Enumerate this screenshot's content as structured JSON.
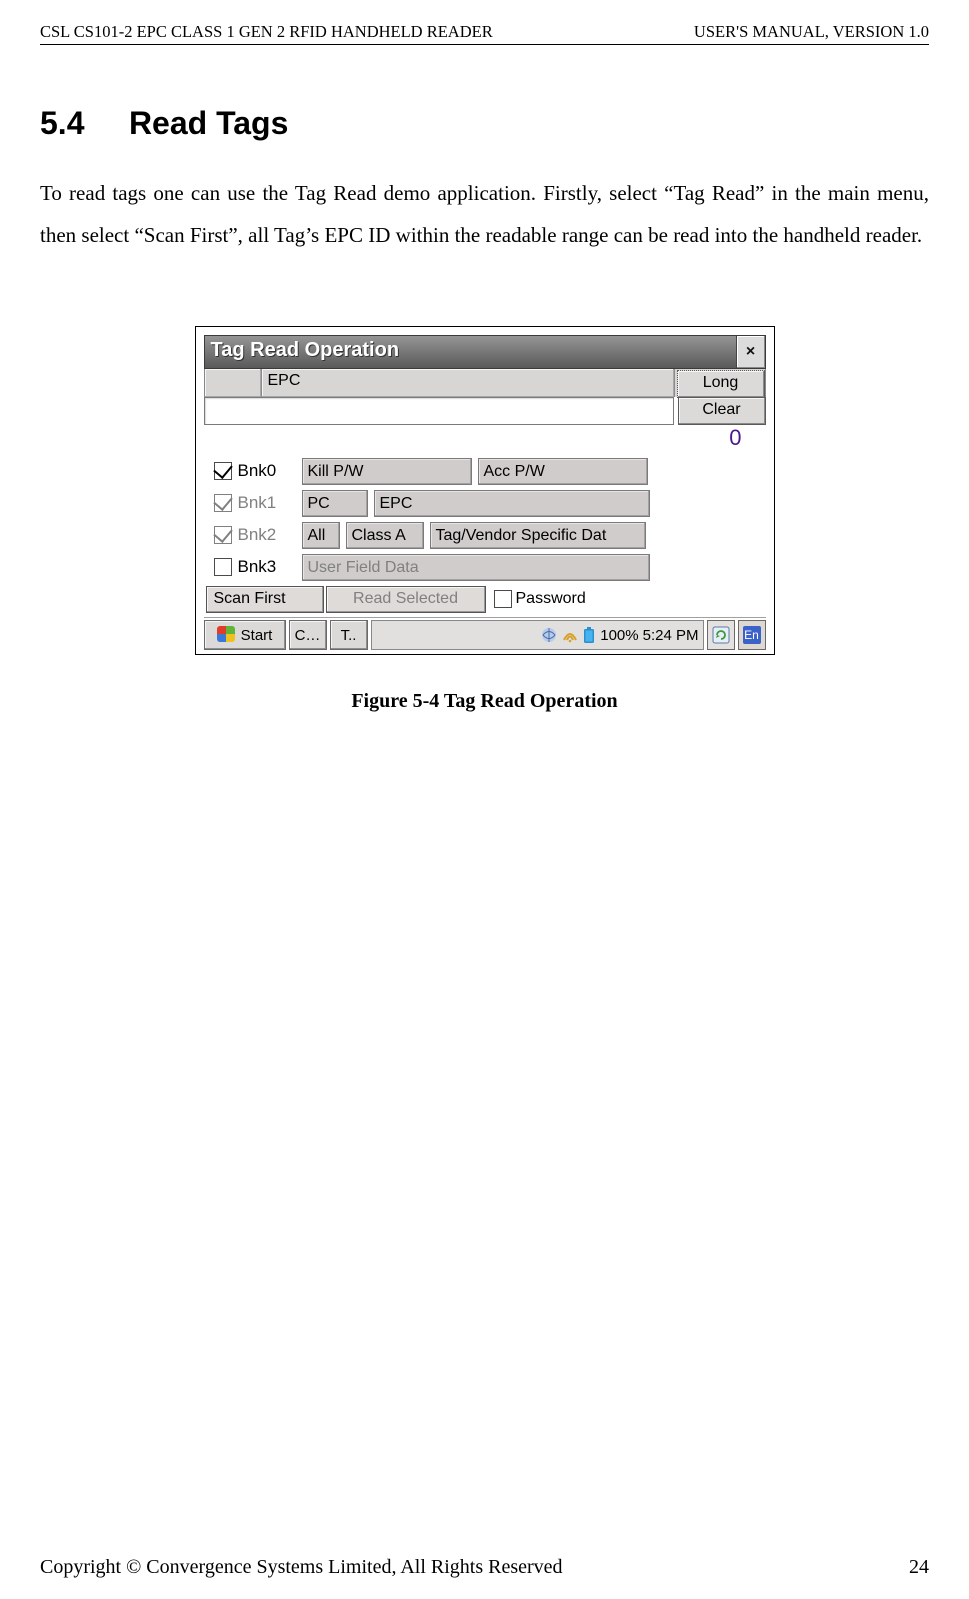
{
  "doc_header_left": "CSL CS101-2 EPC CLASS 1 GEN 2 RFID HANDHELD READER",
  "doc_header_right": "USER'S  MANUAL,  VERSION  1.0",
  "section_number": "5.4",
  "section_title": "Read Tags",
  "body_paragraph": "To read tags one can use the Tag Read demo application. Firstly, select “Tag Read” in the main menu, then select “Scan First”, all Tag’s EPC ID within the readable range can be read into the handheld reader.",
  "figure_caption": "Figure 5-4 Tag Read Operation",
  "footer_left": "Copyright © Convergence Systems Limited, All Rights Reserved",
  "footer_right": "24",
  "window": {
    "title": "Tag Read Operation",
    "close_label": "×",
    "column_epc": "EPC",
    "btn_long": "Long",
    "btn_clear": "Clear",
    "count": "0",
    "bank0": {
      "label": "Bnk0",
      "checked": true,
      "field1": "Kill P/W",
      "field2": "Acc P/W"
    },
    "bank1": {
      "label": "Bnk1",
      "checked": true,
      "field1": "PC",
      "field2": "EPC"
    },
    "bank2": {
      "label": "Bnk2",
      "checked": true,
      "field1": "All",
      "field2": "Class A",
      "field3": "Tag/Vendor Specific Dat"
    },
    "bank3": {
      "label": "Bnk3",
      "checked": false,
      "field1": "User Field Data"
    },
    "btn_scan_first": "Scan First",
    "btn_read_selected": "Read Selected",
    "chk_password_label": "Password",
    "taskbar": {
      "start": "Start",
      "task1": "C…",
      "task2": "T..",
      "battery": "100%",
      "clock": "5:24 PM",
      "ime": "En"
    }
  }
}
